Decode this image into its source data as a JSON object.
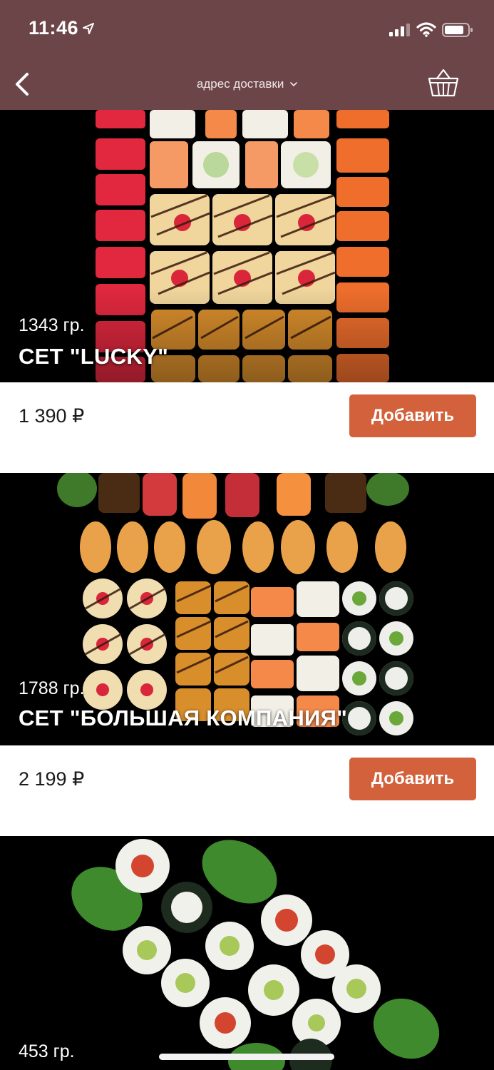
{
  "status_bar": {
    "time": "11:46"
  },
  "header": {
    "address_label": "адрес доставки",
    "background": "#6c4549"
  },
  "products": [
    {
      "weight": "1343 гр.",
      "title": "СЕТ \"LUCKY\"",
      "price": "1 390 ₽",
      "button_label": "Добавить"
    },
    {
      "weight": "1788 гр.",
      "title": "СЕТ \"БОЛЬШАЯ КОМПАНИЯ\"",
      "price": "2 199 ₽",
      "button_label": "Добавить"
    },
    {
      "weight": "453 гр."
    }
  ],
  "colors": {
    "accent": "#d2613c",
    "image_background": "#000000"
  },
  "icons": {
    "back": "chevron-left-icon",
    "address_dropdown": "chevron-down-icon",
    "cart": "basket-icon"
  }
}
